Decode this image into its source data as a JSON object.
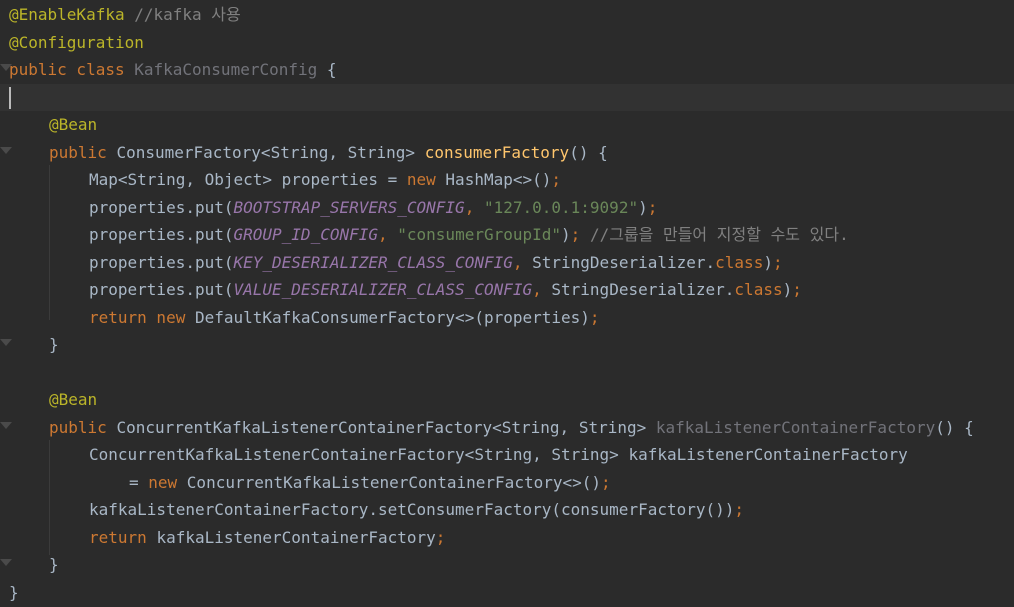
{
  "editor": {
    "colors": {
      "background": "#2b2b2b",
      "current_line": "#323232",
      "annotation": "#bbb529",
      "keyword": "#cc7832",
      "plain": "#a9b7c6",
      "string": "#6a8759",
      "constant": "#9876aa",
      "comment": "#808080",
      "method_decl": "#ffc66d",
      "unused": "#72737a"
    },
    "current_line_index": 3,
    "lines": [
      {
        "indent": 0,
        "tokens": [
          {
            "t": "@EnableKafka",
            "k": "annotation"
          },
          {
            "t": " ",
            "k": "plain"
          },
          {
            "t": "//kafka 사용",
            "k": "comment"
          }
        ]
      },
      {
        "indent": 0,
        "tokens": [
          {
            "t": "@Configuration",
            "k": "annotation"
          }
        ]
      },
      {
        "indent": 0,
        "tokens": [
          {
            "t": "public class ",
            "k": "keyword"
          },
          {
            "t": "KafkaConsumerConfig",
            "k": "unused"
          },
          {
            "t": " {",
            "k": "plain"
          }
        ]
      },
      {
        "indent": 0,
        "tokens": []
      },
      {
        "indent": 1,
        "tokens": [
          {
            "t": "@Bean",
            "k": "annotation"
          }
        ]
      },
      {
        "indent": 1,
        "tokens": [
          {
            "t": "public ",
            "k": "keyword"
          },
          {
            "t": "ConsumerFactory<String, String> ",
            "k": "plain"
          },
          {
            "t": "consumerFactory",
            "k": "method_decl"
          },
          {
            "t": "() {",
            "k": "plain"
          }
        ]
      },
      {
        "indent": 2,
        "tokens": [
          {
            "t": "Map<String, Object> properties = ",
            "k": "plain"
          },
          {
            "t": "new ",
            "k": "keyword"
          },
          {
            "t": "HashMap<>()",
            "k": "plain"
          },
          {
            "t": ";",
            "k": "keyword"
          }
        ]
      },
      {
        "indent": 2,
        "tokens": [
          {
            "t": "properties.put(",
            "k": "plain"
          },
          {
            "t": "BOOTSTRAP_SERVERS_CONFIG",
            "k": "constant",
            "i": true
          },
          {
            "t": ", ",
            "k": "keyword"
          },
          {
            "t": "\"127.0.0.1:9092\"",
            "k": "string"
          },
          {
            "t": ")",
            "k": "plain"
          },
          {
            "t": ";",
            "k": "keyword"
          }
        ]
      },
      {
        "indent": 2,
        "tokens": [
          {
            "t": "properties.put(",
            "k": "plain"
          },
          {
            "t": "GROUP_ID_CONFIG",
            "k": "constant",
            "i": true
          },
          {
            "t": ", ",
            "k": "keyword"
          },
          {
            "t": "\"consumerGroupId\"",
            "k": "string"
          },
          {
            "t": ")",
            "k": "plain"
          },
          {
            "t": "; ",
            "k": "keyword"
          },
          {
            "t": "//그룹을 만들어 지정할 수도 있다.",
            "k": "comment"
          }
        ]
      },
      {
        "indent": 2,
        "tokens": [
          {
            "t": "properties.put(",
            "k": "plain"
          },
          {
            "t": "KEY_DESERIALIZER_CLASS_CONFIG",
            "k": "constant",
            "i": true
          },
          {
            "t": ", ",
            "k": "keyword"
          },
          {
            "t": "StringDeserializer.",
            "k": "plain"
          },
          {
            "t": "class",
            "k": "keyword"
          },
          {
            "t": ")",
            "k": "plain"
          },
          {
            "t": ";",
            "k": "keyword"
          }
        ]
      },
      {
        "indent": 2,
        "tokens": [
          {
            "t": "properties.put(",
            "k": "plain"
          },
          {
            "t": "VALUE_DESERIALIZER_CLASS_CONFIG",
            "k": "constant",
            "i": true
          },
          {
            "t": ", ",
            "k": "keyword"
          },
          {
            "t": "StringDeserializer.",
            "k": "plain"
          },
          {
            "t": "class",
            "k": "keyword"
          },
          {
            "t": ")",
            "k": "plain"
          },
          {
            "t": ";",
            "k": "keyword"
          }
        ]
      },
      {
        "indent": 2,
        "tokens": [
          {
            "t": "return new ",
            "k": "keyword"
          },
          {
            "t": "DefaultKafkaConsumerFactory<>(properties)",
            "k": "plain"
          },
          {
            "t": ";",
            "k": "keyword"
          }
        ]
      },
      {
        "indent": 1,
        "tokens": [
          {
            "t": "}",
            "k": "plain"
          }
        ]
      },
      {
        "indent": 0,
        "tokens": []
      },
      {
        "indent": 1,
        "tokens": [
          {
            "t": "@Bean",
            "k": "annotation"
          }
        ]
      },
      {
        "indent": 1,
        "tokens": [
          {
            "t": "public ",
            "k": "keyword"
          },
          {
            "t": "ConcurrentKafkaListenerContainerFactory<String, String> ",
            "k": "plain"
          },
          {
            "t": "kafkaListenerContainerFactory",
            "k": "unused"
          },
          {
            "t": "() {",
            "k": "plain"
          }
        ]
      },
      {
        "indent": 2,
        "tokens": [
          {
            "t": "ConcurrentKafkaListenerContainerFactory<String, String> kafkaListenerContainerFactory",
            "k": "plain"
          }
        ]
      },
      {
        "indent": 3,
        "tokens": [
          {
            "t": "= ",
            "k": "plain"
          },
          {
            "t": "new ",
            "k": "keyword"
          },
          {
            "t": "ConcurrentKafkaListenerContainerFactory<>()",
            "k": "plain"
          },
          {
            "t": ";",
            "k": "keyword"
          }
        ]
      },
      {
        "indent": 2,
        "tokens": [
          {
            "t": "kafkaListenerContainerFactory.setConsumerFactory(consumerFactory())",
            "k": "plain"
          },
          {
            "t": ";",
            "k": "keyword"
          }
        ]
      },
      {
        "indent": 2,
        "tokens": [
          {
            "t": "return ",
            "k": "keyword"
          },
          {
            "t": "kafkaListenerContainerFactory",
            "k": "plain"
          },
          {
            "t": ";",
            "k": "keyword"
          }
        ]
      },
      {
        "indent": 1,
        "tokens": [
          {
            "t": "}",
            "k": "plain"
          }
        ]
      },
      {
        "indent": 0,
        "tokens": [
          {
            "t": "}",
            "k": "plain"
          }
        ]
      }
    ]
  }
}
